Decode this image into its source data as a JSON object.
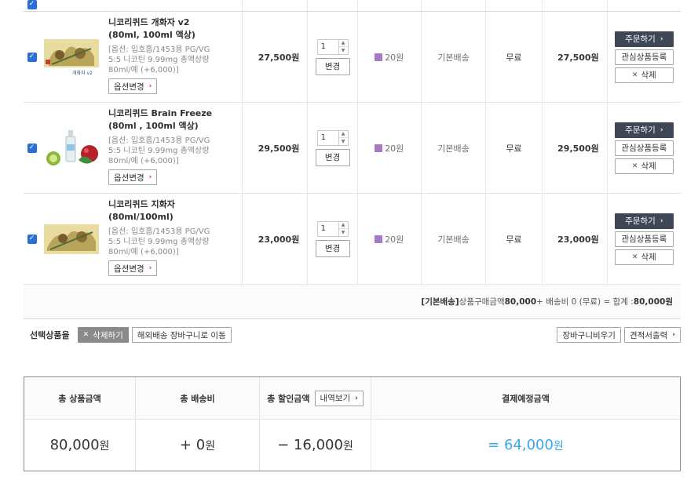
{
  "cart": {
    "items": [
      {
        "name": "니코리퀴드 개화자 v2 (80ml, 100ml 액상)",
        "option": "[옵션: 입호흡/1453용 PG/VG 5:5 니코틴 9.99mg 총액상량 80ml/예 (+6,000)]",
        "option_change_label": "옵션변경",
        "price": "27,500원",
        "qty": "1",
        "qty_change_label": "변경",
        "points": "20원",
        "shipping": "기본배송",
        "ship_fee": "무료",
        "total": "27,500원",
        "order_label": "주문하기",
        "wish_label": "관심상품등록",
        "delete_label": "삭제",
        "thumb_caption": "개화자 v2"
      },
      {
        "name": "니코리퀴드 Brain Freeze (80ml , 100ml 액상)",
        "option": "[옵션: 입호흡/1453용 PG/VG 5:5 니코틴 9.99mg 총액상량 80ml/예 (+6,000)]",
        "option_change_label": "옵션변경",
        "price": "29,500원",
        "qty": "1",
        "qty_change_label": "변경",
        "points": "20원",
        "shipping": "기본배송",
        "ship_fee": "무료",
        "total": "29,500원",
        "order_label": "주문하기",
        "wish_label": "관심상품등록",
        "delete_label": "삭제"
      },
      {
        "name": "니코리퀴드 지화자 (80ml/100ml)",
        "option": "[옵션: 입호흡/1453용 PG/VG 5:5 니코틴 9.99mg 총액상량 80ml/예 (+6,000)]",
        "option_change_label": "옵션변경",
        "price": "23,000원",
        "qty": "1",
        "qty_change_label": "변경",
        "points": "20원",
        "shipping": "기본배송",
        "ship_fee": "무료",
        "total": "23,000원",
        "order_label": "주문하기",
        "wish_label": "관심상품등록",
        "delete_label": "삭제"
      }
    ],
    "summary": {
      "label": "[기본배송]",
      "text_a": " 상품구매금액 ",
      "amount": "80,000",
      "text_b": " + 배송비 0 (무료) = 합계 : ",
      "sum": "80,000원"
    }
  },
  "selection": {
    "label": "선택상품을",
    "delete_label": "삭제하기",
    "move_overseas_label": "해외배송 장바구니로 이동",
    "empty_cart_label": "장바구니비우기",
    "quote_label": "견적서출력"
  },
  "totals": {
    "product_total_label": "총 상품금액",
    "shipping_label": "총 배송비",
    "discount_label": "총 할인금액",
    "details_label": "내역보기",
    "final_label": "결제예정금액",
    "product_total_num": "80,000",
    "shipping_num": "+ 0",
    "discount_num": "− 16,000",
    "final_num": "= 64,000",
    "unit": "원"
  },
  "colors": {
    "order_button_bg": "#3f4656",
    "final_amount": "#3ba6e8",
    "checkbox": "#2a6fd6",
    "points_icon": "#a678c6",
    "arrow_red": "#d82c2c"
  },
  "icons": {
    "checkbox": "checked-checkbox-icon",
    "arrow": "chevron-right-icon",
    "delete": "x-icon",
    "points": "points-icon"
  }
}
